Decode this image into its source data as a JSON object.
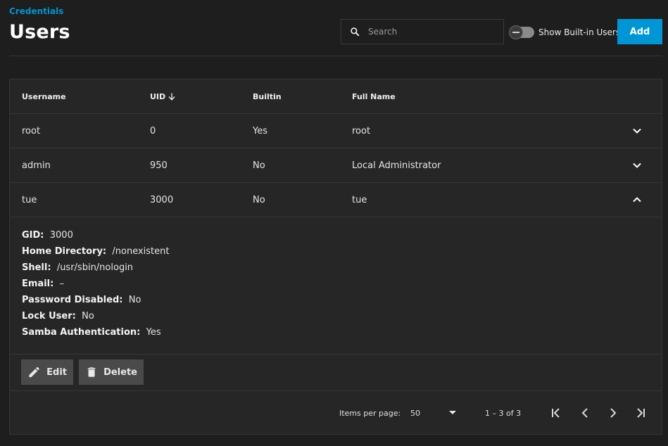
{
  "header": {
    "breadcrumb": "Credentials",
    "title": "Users",
    "search_placeholder": "Search",
    "toggle_label": "Show Built-in Users",
    "add_label": "Add"
  },
  "table": {
    "columns": [
      "Username",
      "UID",
      "Builtin",
      "Full Name"
    ],
    "sorted_column": "UID",
    "rows": [
      {
        "username": "root",
        "uid": "0",
        "builtin": "Yes",
        "full_name": "root",
        "expanded": false
      },
      {
        "username": "admin",
        "uid": "950",
        "builtin": "No",
        "full_name": "Local Administrator",
        "expanded": false
      },
      {
        "username": "tue",
        "uid": "3000",
        "builtin": "No",
        "full_name": "tue",
        "expanded": true
      }
    ],
    "details": [
      {
        "label": "GID:",
        "value": "3000"
      },
      {
        "label": "Home Directory:",
        "value": "/nonexistent"
      },
      {
        "label": "Shell:",
        "value": "/usr/sbin/nologin"
      },
      {
        "label": "Email:",
        "value": "–"
      },
      {
        "label": "Password Disabled:",
        "value": "No"
      },
      {
        "label": "Lock User:",
        "value": "No"
      },
      {
        "label": "Samba Authentication:",
        "value": "Yes"
      }
    ],
    "actions": {
      "edit_label": "Edit",
      "delete_label": "Delete"
    }
  },
  "paginator": {
    "items_per_page_label": "Items per page:",
    "items_per_page_value": "50",
    "range_label": "1 – 3 of 3"
  },
  "colors": {
    "accent": "#0095d5",
    "background": "#1e1e1e",
    "card": "#262626"
  }
}
